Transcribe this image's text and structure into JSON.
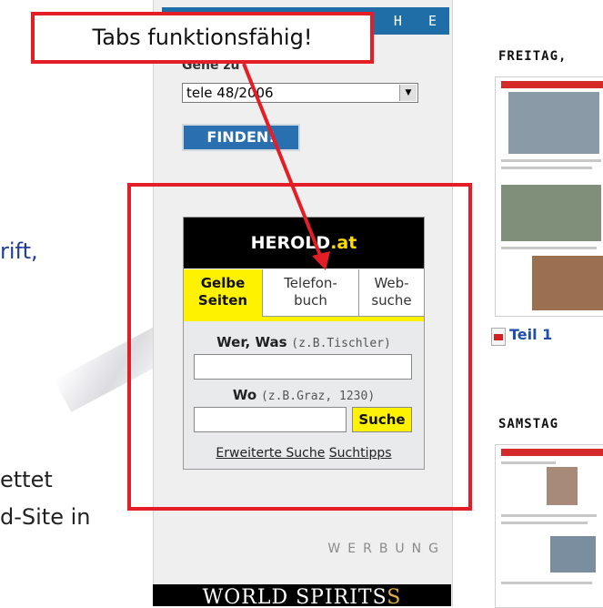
{
  "slide_fragments": {
    "line1": "rift,",
    "line2": "ettet",
    "line3": "d-Site in"
  },
  "header": {
    "suche_bar": "C H E"
  },
  "search_panel": {
    "gehe_label": "Gehe zu",
    "issue_value": "tele 48/2006",
    "finden_label": "FINDEN!"
  },
  "herold": {
    "logo_main": "HEROLD",
    "logo_suffix": ".at",
    "tabs": [
      {
        "line1": "Gelbe",
        "line2": "Seiten"
      },
      {
        "line1": "Telefon-",
        "line2": "buch"
      },
      {
        "line1": "Web-",
        "line2": "suche"
      }
    ],
    "wer_label": "Wer, Was",
    "wer_hint": "(z.B.Tischler)",
    "wo_label": "Wo",
    "wo_hint": "(z.B.Graz, 1230)",
    "suche_button": "Suche",
    "link_erweitert": "Erweiterte Suche",
    "link_tipps": "Suchtipps"
  },
  "werbung": "WERBUNG",
  "ad_banner": "WORLD SPIRITS",
  "right_column": {
    "day1": "FREITAG,",
    "day2": "SAMSTAG",
    "teil_link": "Teil 1"
  },
  "annotation": {
    "callout_text": "Tabs funktionsfähig!"
  },
  "colors": {
    "annotation_red": "#e41e26",
    "herold_yellow": "#fff200",
    "suche_blue": "#1f6ea8"
  }
}
